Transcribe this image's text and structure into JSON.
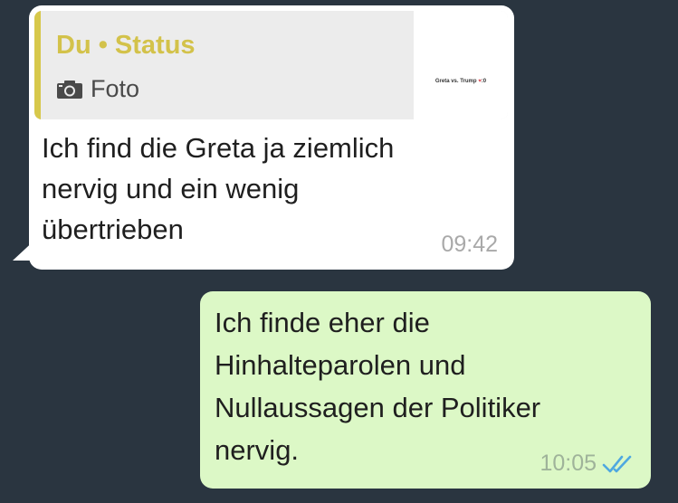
{
  "incoming_message": {
    "quote": {
      "title": "Du • Status",
      "type_label": "Foto",
      "type_icon": "camera-icon",
      "thumbnail_caption": "Greta vs. Trump",
      "thumbnail_suffix": ":0"
    },
    "text": "Ich find die Greta ja ziemlich\nnervig und ein wenig\nübertrieben",
    "time": "09:42"
  },
  "outgoing_message": {
    "text": "Ich finde eher die\nHinhalteparolen und\nNullaussagen der Politiker\nnervig.",
    "time": "10:05",
    "status_icon": "double-check-icon",
    "status": "read"
  },
  "colors": {
    "background": "#2a3540",
    "incoming_bubble": "#ffffff",
    "outgoing_bubble": "#dcf8c6",
    "quote_accent": "#d3c24a",
    "read_check": "#4fa8e0"
  }
}
